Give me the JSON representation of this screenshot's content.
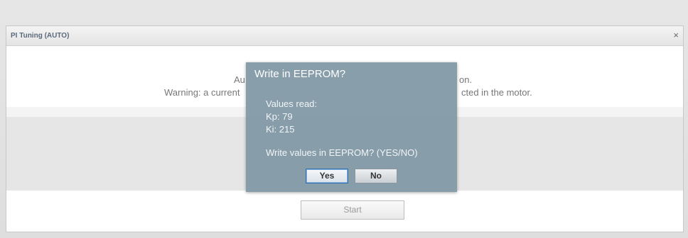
{
  "panel": {
    "title": "PI Tuning (AUTO)",
    "close_label": "×",
    "info_line1": "Au",
    "info_line1_tail": "on.",
    "info_line2": "Warning: a current",
    "info_line2_tail": "cted in the motor.",
    "start_label": "Start"
  },
  "dialog": {
    "title": "Write in EEPROM?",
    "values_heading": "Values read:",
    "kp_line": "Kp: 79",
    "ki_line": "Ki: 215",
    "question": "Write values in EEPROM? (YES/NO)",
    "yes_label": "Yes",
    "no_label": "No"
  }
}
